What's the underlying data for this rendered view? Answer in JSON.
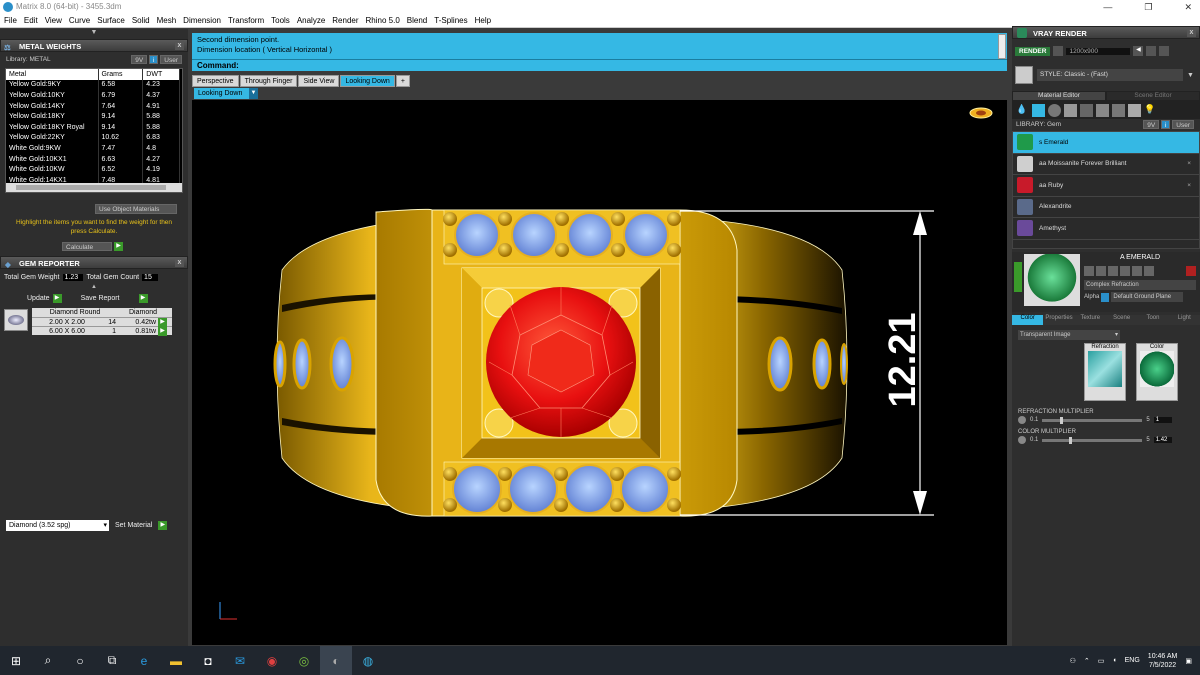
{
  "window": {
    "title": "Matrix 8.0 (64-bit) - 3455.3dm",
    "min": "—",
    "max": "❐",
    "close": "✕"
  },
  "menu": [
    "File",
    "Edit",
    "View",
    "Curve",
    "Surface",
    "Solid",
    "Mesh",
    "Dimension",
    "Transform",
    "Tools",
    "Analyze",
    "Render",
    "Rhino 5.0",
    "Blend",
    "T-Splines",
    "Help"
  ],
  "metal": {
    "title": "METAL WEIGHTS",
    "library_label": "Library: METAL",
    "btn_9v": "9V",
    "btn_i": "i",
    "btn_user": "User",
    "headers": [
      "Metal",
      "Grams",
      "DWT"
    ],
    "rows": [
      [
        "Yellow Gold:9KY",
        "6.58",
        "4.23"
      ],
      [
        "Yellow Gold:10KY",
        "6.79",
        "4.37"
      ],
      [
        "Yellow Gold:14KY",
        "7.64",
        "4.91"
      ],
      [
        "Yellow Gold:18KY",
        "9.14",
        "5.88"
      ],
      [
        "Yellow Gold:18KY Royal",
        "9.14",
        "5.88"
      ],
      [
        "Yellow Gold:22KY",
        "10.62",
        "6.83"
      ],
      [
        "White Gold:9KW",
        "7.47",
        "4.8"
      ],
      [
        "White Gold:10KX1",
        "6.63",
        "4.27"
      ],
      [
        "White Gold:10KW",
        "6.52",
        "4.19"
      ],
      [
        "White Gold:14KX1",
        "7.48",
        "4.81"
      ]
    ],
    "use_object": "Use Object Materials",
    "highlight": "Highlight the items you want to find the weight for then press Calculate.",
    "calc": "Calculate"
  },
  "gemrep": {
    "title": "GEM REPORTER",
    "total_weight_label": "Total Gem Weight",
    "total_weight": "1.23",
    "total_count_label": "Total Gem Count",
    "total_count": "15",
    "update": "Update",
    "save": "Save Report",
    "headers": [
      "Diamond Round",
      "Diamond"
    ],
    "rows": [
      [
        "2.00 X 2.00",
        "14",
        "0.42tw"
      ],
      [
        "6.00 X 6.00",
        "1",
        "0.81tw"
      ]
    ],
    "material": "Diamond    (3.52 spg)",
    "set_material": "Set Material"
  },
  "prompt": {
    "line1": "Second dimension point.",
    "line2": "Dimension location ( Vertical  Horizontal )",
    "command": "Command:"
  },
  "tabs": [
    "Perspective",
    "Through Finger",
    "Side View",
    "Looking Down",
    "+"
  ],
  "view_select": "Looking Down",
  "dimension": "12.21",
  "vray": {
    "title": "VRAY RENDER",
    "render": "RENDER",
    "resolution": "1200x900",
    "style": "STYLE:  Classic - (Fast)",
    "tab_material": "Material Editor",
    "tab_scene": "Scene Editor",
    "library": "LIBRARY: Gem",
    "btn_9v": "9V",
    "btn_i": "i",
    "btn_user": "User",
    "gems": [
      {
        "name": "s Emerald",
        "color": "#1f9a4a"
      },
      {
        "name": "aa Moissanite Forever Brilliant",
        "color": "#cfcfcf"
      },
      {
        "name": "aa Ruby",
        "color": "#c81a2a"
      },
      {
        "name": "Alexandrite",
        "color": "#5a6a8a"
      },
      {
        "name": "Amethyst",
        "color": "#6a4a9a"
      }
    ],
    "preview_name": "A EMERALD",
    "shader": "Complex Refraction",
    "alpha": "Alpha",
    "ground": "Default Ground Plane",
    "subtabs": [
      "Color",
      "Properties",
      "Texture",
      "Scene",
      "Toon",
      "Light"
    ],
    "transparent": "Transparent Image",
    "refraction": "Refraction",
    "color": "Color",
    "refr_mult": "REFRACTION MULTIPLIER",
    "refr_min": "0.1",
    "refr_max": "5",
    "refr_val": "1",
    "color_mult": "COLOR MULTIPLIER",
    "color_min": "0.1",
    "color_max": "5",
    "color_val": "1.42"
  },
  "taskbar": {
    "lang": "ENG",
    "time": "10:46 AM",
    "date": "7/5/2022"
  }
}
